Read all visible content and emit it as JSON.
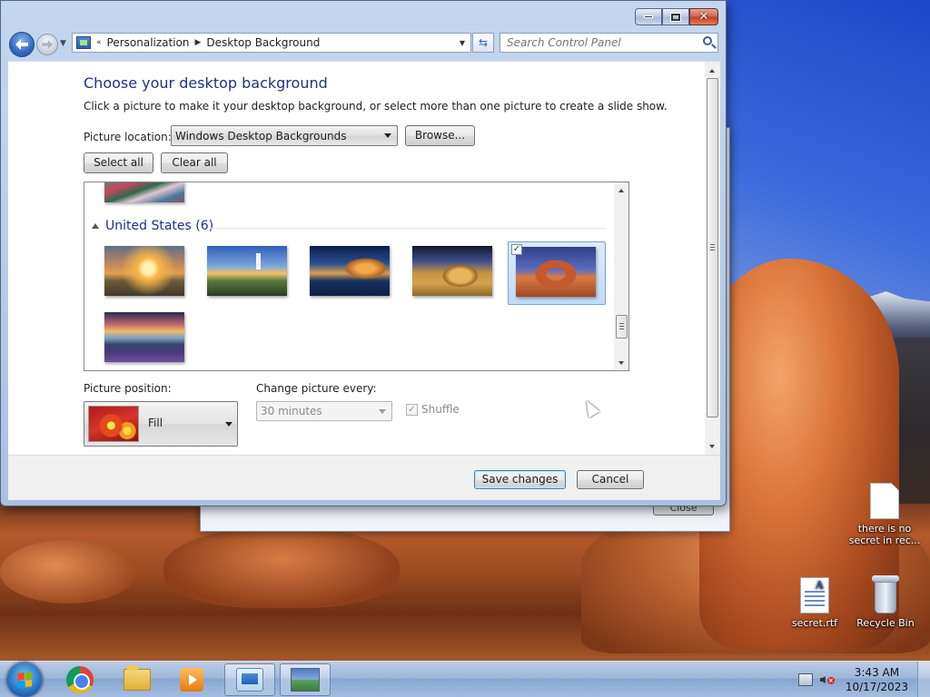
{
  "window": {
    "breadcrumb": [
      "Personalization",
      "Desktop Background"
    ],
    "search_placeholder": "Search Control Panel",
    "heading": "Choose your desktop background",
    "subtext": "Click a picture to make it your desktop background, or select more than one picture to create a slide show.",
    "picture_location_label": "Picture location:",
    "picture_location_value": "Windows Desktop Backgrounds",
    "browse_label": "Browse...",
    "select_all_label": "Select all",
    "clear_all_label": "Clear all",
    "group_name": "United States (6)",
    "thumbnails": [
      {
        "theme": "sunset-prairie",
        "selected": false
      },
      {
        "theme": "lighthouse-coast",
        "selected": false
      },
      {
        "theme": "ocean-rock",
        "selected": false
      },
      {
        "theme": "hay-bale",
        "selected": false
      },
      {
        "theme": "delicate-arch",
        "selected": true
      },
      {
        "theme": "lupine-lake",
        "selected": false
      }
    ],
    "picture_position_label": "Picture position:",
    "picture_position_value": "Fill",
    "change_picture_label": "Change picture every:",
    "interval_value": "30 minutes",
    "shuffle_label": "Shuffle",
    "shuffle_checked": true,
    "save_label": "Save changes",
    "cancel_label": "Cancel"
  },
  "background_dialog": {
    "close_label": "Close"
  },
  "desktop_icons": [
    {
      "label": "there is no secret in rec...",
      "icon": "text-document-icon"
    },
    {
      "label": "secret.rtf",
      "icon": "rtf-document-icon"
    },
    {
      "label": "Recycle Bin",
      "icon": "recycle-bin-icon"
    }
  ],
  "taskbar": {
    "apps": [
      "chrome",
      "windows-explorer",
      "windows-media-player",
      "control-panel",
      "personalization"
    ],
    "active_app": "personalization",
    "time": "3:43 AM",
    "date": "10/17/2023"
  }
}
